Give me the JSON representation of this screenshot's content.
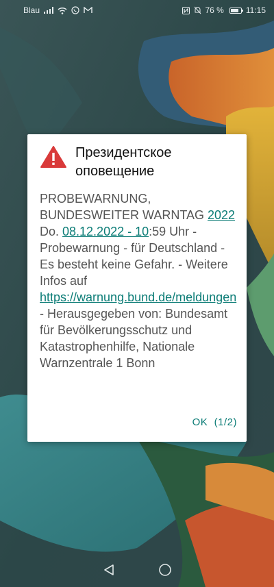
{
  "statusbar": {
    "carrier": "Blau",
    "battery_percent": "76 %",
    "battery_level": 0.76,
    "time": "11:15",
    "icons": [
      "signal-icon",
      "wifi-icon",
      "whatsapp-icon",
      "gmail-icon",
      "nfc-icon",
      "mute-bell-icon",
      "battery-icon"
    ]
  },
  "dialog": {
    "icon": "warning-triangle-icon",
    "title": "Президентское оповещение",
    "message": {
      "t1": "PROBEWARNUNG, BUNDESWEITER WARNTAG ",
      "link1": "2022",
      "t2": "Do. ",
      "link2": "08.12.2022 - 10",
      "t3": ":59 Uhr - Probewarnung - für Deutschland - Es besteht keine Gefahr. - Weitere Infos auf ",
      "link3": "https://warnung.bund.de/meldungen",
      "t4": " - Herausgegeben von: Bundesamt für Bevölkerungsschutz und Katastrophenhilfe, Nationale Warnzentrale 1 Bonn"
    },
    "ok_label": "OK",
    "page_label": "(1/2)"
  },
  "navbar": {
    "back": "back-icon",
    "home": "home-icon"
  },
  "colors": {
    "accent": "#0d7d77",
    "warning": "#d93a3a"
  }
}
